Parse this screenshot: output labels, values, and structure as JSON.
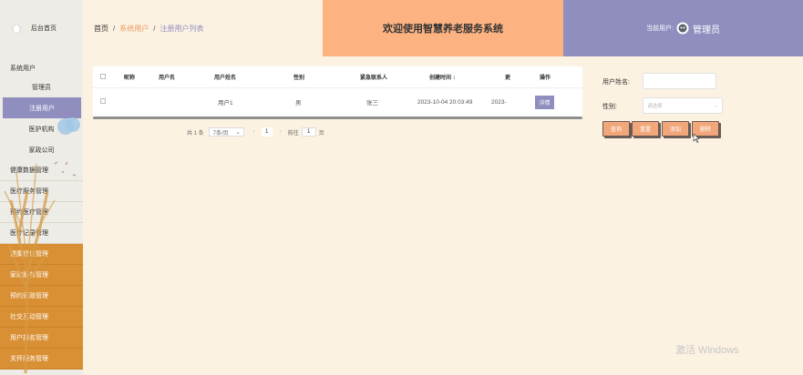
{
  "sidebar": {
    "home_label": "后台首页",
    "group_label": "系统用户",
    "sub_items": [
      {
        "label": "管理员"
      },
      {
        "label": "注册用户"
      },
      {
        "label": "医护机构"
      },
      {
        "label": "家政公司"
      }
    ],
    "categories": [
      {
        "label": "健康数据管理"
      },
      {
        "label": "医疗服务管理"
      },
      {
        "label": "预约医疗管理"
      },
      {
        "label": "医疗记录管理"
      }
    ],
    "orange_categories": [
      {
        "label": "健康建议管理"
      },
      {
        "label": "家政服务管理"
      },
      {
        "label": "预约家政管理"
      },
      {
        "label": "社交互动管理"
      },
      {
        "label": "用户报名管理"
      },
      {
        "label": "关怀服务管理"
      }
    ]
  },
  "header": {
    "breadcrumb": [
      "首页",
      "系统用户",
      "注册用户列表"
    ],
    "welcome": "欢迎使用智慧养老服务系统",
    "current_user_label": "当前用户:",
    "current_user": "管理员"
  },
  "table": {
    "headers": [
      "昵称",
      "用户名",
      "用户姓名",
      "性别",
      "紧急联系人",
      "创建时间 ↕",
      "更",
      "操作"
    ],
    "rows": [
      {
        "nickname": "",
        "username": "",
        "realname": "用户1",
        "gender": "男",
        "contact": "张三",
        "created": "2023-10-04 20:03:49",
        "updated": "2023-",
        "action": "详情"
      }
    ]
  },
  "pagination": {
    "total": "共 1 条",
    "page_size": "7条/页",
    "current_page": "1",
    "goto_label": "前往",
    "goto_value": "1",
    "page_suffix": "页"
  },
  "search": {
    "username_label": "用户姓名:",
    "username_value": "",
    "gender_label": "性别:",
    "gender_placeholder": "请选择",
    "buttons": {
      "query": "查询",
      "reset": "重置",
      "add": "添加",
      "delete": "删除"
    }
  },
  "watermark": "激活 Windows",
  "colors": {
    "accent_purple": "#8f8ebf",
    "accent_orange": "#fdb282",
    "sidebar_orange": "#d98f33",
    "background": "#fcf2e2"
  }
}
